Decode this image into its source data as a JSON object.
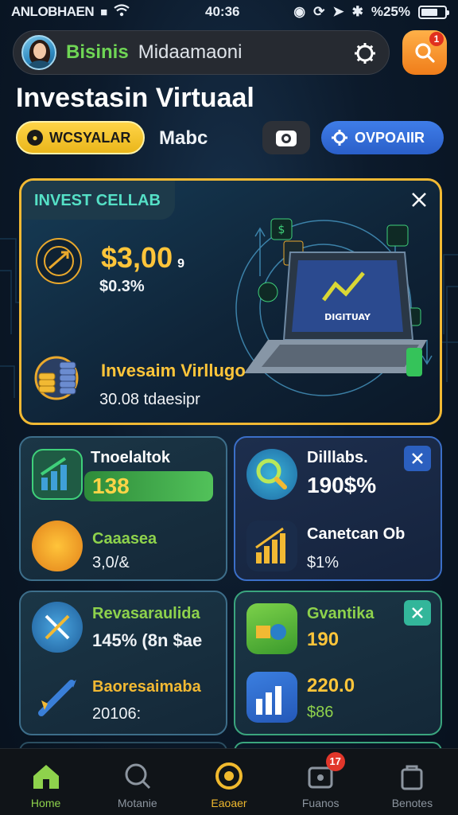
{
  "status_bar": {
    "carrier": "ANLOBHAEN",
    "time": "40:36",
    "battery": "%25%"
  },
  "search": {
    "brand": "Bisinis",
    "text": "Midaamaoni",
    "notification_count": "1"
  },
  "page_title": "Investasin Virtuaal",
  "tabs": {
    "chip_yellow": "WCSYALAR",
    "middle": "Mabc",
    "chip_blue": "OVPOAIIR"
  },
  "hero": {
    "label": "INVEST CELLAB",
    "amount": "$3,00",
    "amount_suffix": "9",
    "sub": "$0.3%",
    "laptop_screen": "DIGITUAY",
    "title": "Invesaim Virllugo",
    "meta": "30.08 tdaesipr"
  },
  "cards": [
    {
      "top_title": "Tnoelaltok",
      "top_value": "138",
      "bottom_title": "Caaasea",
      "bottom_value": "3,0/&"
    },
    {
      "top_title": "Dilllabs.",
      "top_value": "190$%",
      "bottom_title": "Canetcan Ob",
      "bottom_value": "$1%"
    },
    {
      "top_title": "Revasaraulida",
      "top_value": "145% (8n $ae",
      "bottom_title": "Baoresaimaba",
      "bottom_value": "20106:"
    },
    {
      "top_title": "Gvantika",
      "top_value": "190",
      "bottom_title": "220.0",
      "bottom_value": "$86"
    }
  ],
  "nav": [
    {
      "label": "Home"
    },
    {
      "label": "Motanie"
    },
    {
      "label": "Eaoaer"
    },
    {
      "label": "Fuanos",
      "badge": "17"
    },
    {
      "label": "Benotes"
    }
  ],
  "colors": {
    "accent_green": "#8ed24c",
    "accent_gold": "#f2b933",
    "accent_blue": "#3f7de8",
    "card_teal": "#3aa57e"
  }
}
